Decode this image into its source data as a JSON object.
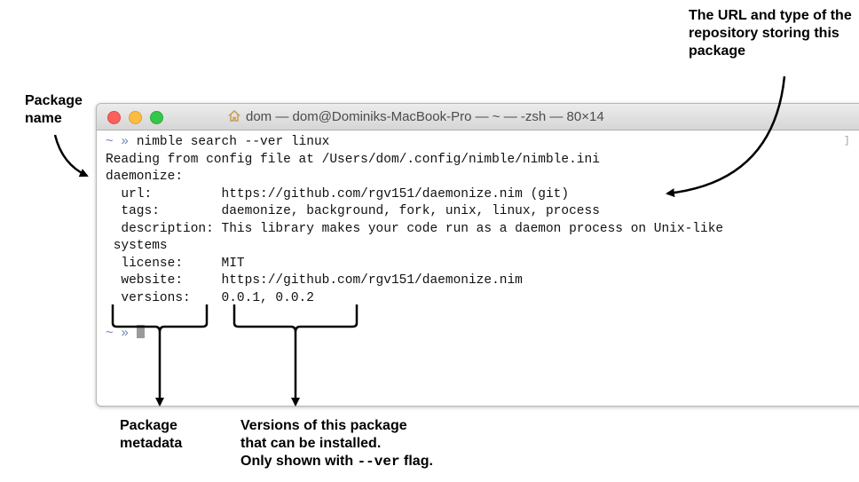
{
  "annotations": {
    "package_name": "Package name",
    "repo_url": "The URL and type of the repository storing this package",
    "package_metadata": "Package metadata",
    "versions_line1": "Versions of this package",
    "versions_line2": "that can be installed.",
    "versions_line3_a": "Only shown with ",
    "versions_line3_flag": "--ver",
    "versions_line3_b": " flag."
  },
  "window": {
    "title": "dom — dom@Dominiks-MacBook-Pro — ~ — -zsh — 80×14",
    "title_icon": "home-icon"
  },
  "terminal": {
    "prompt": "~ »",
    "command": "nimble search --ver linux",
    "lines": [
      "Reading from config file at /Users/dom/.config/nimble/nimble.ini",
      "daemonize:",
      "  url:         https://github.com/rgv151/daemonize.nim (git)",
      "  tags:        daemonize, background, fork, unix, linux, process",
      "  description: This library makes your code run as a daemon process on Unix-like",
      " systems",
      "  license:     MIT",
      "  website:     https://github.com/rgv151/daemonize.nim",
      "  versions:    0.0.1, 0.0.2"
    ],
    "final_prompt": "~ »"
  }
}
